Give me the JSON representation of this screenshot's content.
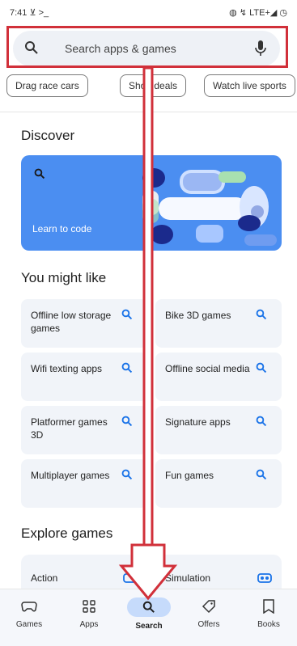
{
  "status": {
    "time": "7:41  ⊻ >_",
    "right": "◍ ↯ LTE+◢ ◷"
  },
  "search": {
    "placeholder": "Search apps & games"
  },
  "chips": [
    "Drag race cars",
    "Shop deals",
    "Watch live sports"
  ],
  "discover": {
    "title": "Discover",
    "card_label": "Learn to code",
    "card_color": "#4b8ef1"
  },
  "you_might_like": {
    "title": "You might like",
    "items": [
      {
        "label": "Offline low storage games"
      },
      {
        "label": "Bike 3D games"
      },
      {
        "label": "Wifi texting apps"
      },
      {
        "label": "Offline social media"
      },
      {
        "label": "Platformer games 3D"
      },
      {
        "label": "Signature apps"
      },
      {
        "label": "Multiplayer games"
      },
      {
        "label": "Fun games"
      }
    ]
  },
  "explore_games": {
    "title": "Explore games",
    "cards": [
      {
        "label": "Action"
      },
      {
        "label": "Simulation"
      }
    ]
  },
  "bottom_nav": {
    "items": [
      {
        "label": "Games",
        "icon": "gamepad-icon"
      },
      {
        "label": "Apps",
        "icon": "apps-grid-icon"
      },
      {
        "label": "Search",
        "icon": "search-icon",
        "active": true
      },
      {
        "label": "Offers",
        "icon": "tag-icon"
      },
      {
        "label": "Books",
        "icon": "bookmark-icon"
      }
    ]
  },
  "colors": {
    "accent": "#1a73e8",
    "annotation": "#d1303a"
  }
}
